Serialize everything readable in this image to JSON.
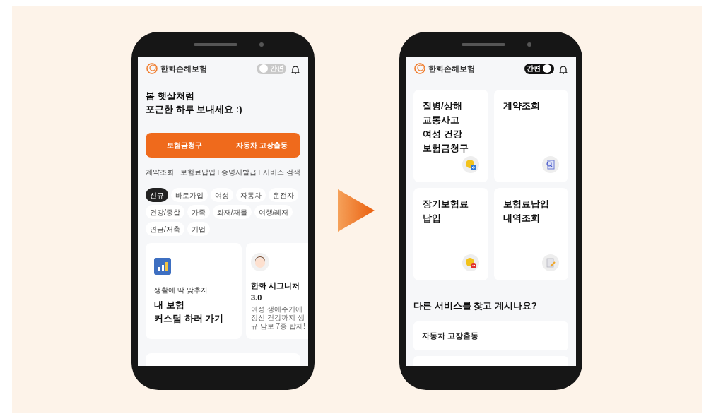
{
  "phones": [
    {
      "kind": "home",
      "header": {
        "brand": "한화손해보험",
        "toggle": {
          "label": "간편",
          "on": false
        }
      },
      "greeting": "봄 햇살처럼\n포근한 하루 보내세요 :)",
      "actions": [
        "보험금청구",
        "자동차 고장출동"
      ],
      "quick_links": [
        "계약조회",
        "보험료납입",
        "증명서발급",
        "서비스 검색"
      ],
      "chips": [
        {
          "label": "신규",
          "selected": true
        },
        {
          "label": "바로가입",
          "selected": false
        },
        {
          "label": "여성",
          "selected": false
        },
        {
          "label": "자동차",
          "selected": false
        },
        {
          "label": "운전자",
          "selected": false
        },
        {
          "label": "건강/종합",
          "selected": false
        },
        {
          "label": "가족",
          "selected": false
        },
        {
          "label": "화재/재물",
          "selected": false
        },
        {
          "label": "여행/레저",
          "selected": false
        },
        {
          "label": "연금/저축",
          "selected": false
        },
        {
          "label": "기업",
          "selected": false
        }
      ],
      "cards": [
        {
          "kind": "custom",
          "subtitle": "생활에 딱 맞추자",
          "title": "내 보험\n커스텀 하러 가기"
        },
        {
          "kind": "product",
          "title": "한화 시그니처\n3.0",
          "description": "여성 생애주기에\n정신 건강까지 생\n규 담보 7종 탑재!"
        }
      ]
    },
    {
      "kind": "services",
      "header": {
        "brand": "한화손해보험",
        "toggle": {
          "label": "간편",
          "on": true
        }
      },
      "tiles": [
        {
          "kind": "claim",
          "title": "질병/상해\n교통사고\n여성 건강\n보험금청구"
        },
        {
          "kind": "lookup",
          "title": "계약조회"
        },
        {
          "kind": "payment",
          "title": "장기보험료\n납입"
        },
        {
          "kind": "history",
          "title": "보험료납입\n내역조회"
        }
      ],
      "more_heading": "다른 서비스를 찾고 계시나요?",
      "services": [
        "자동차 고장출동"
      ]
    }
  ]
}
